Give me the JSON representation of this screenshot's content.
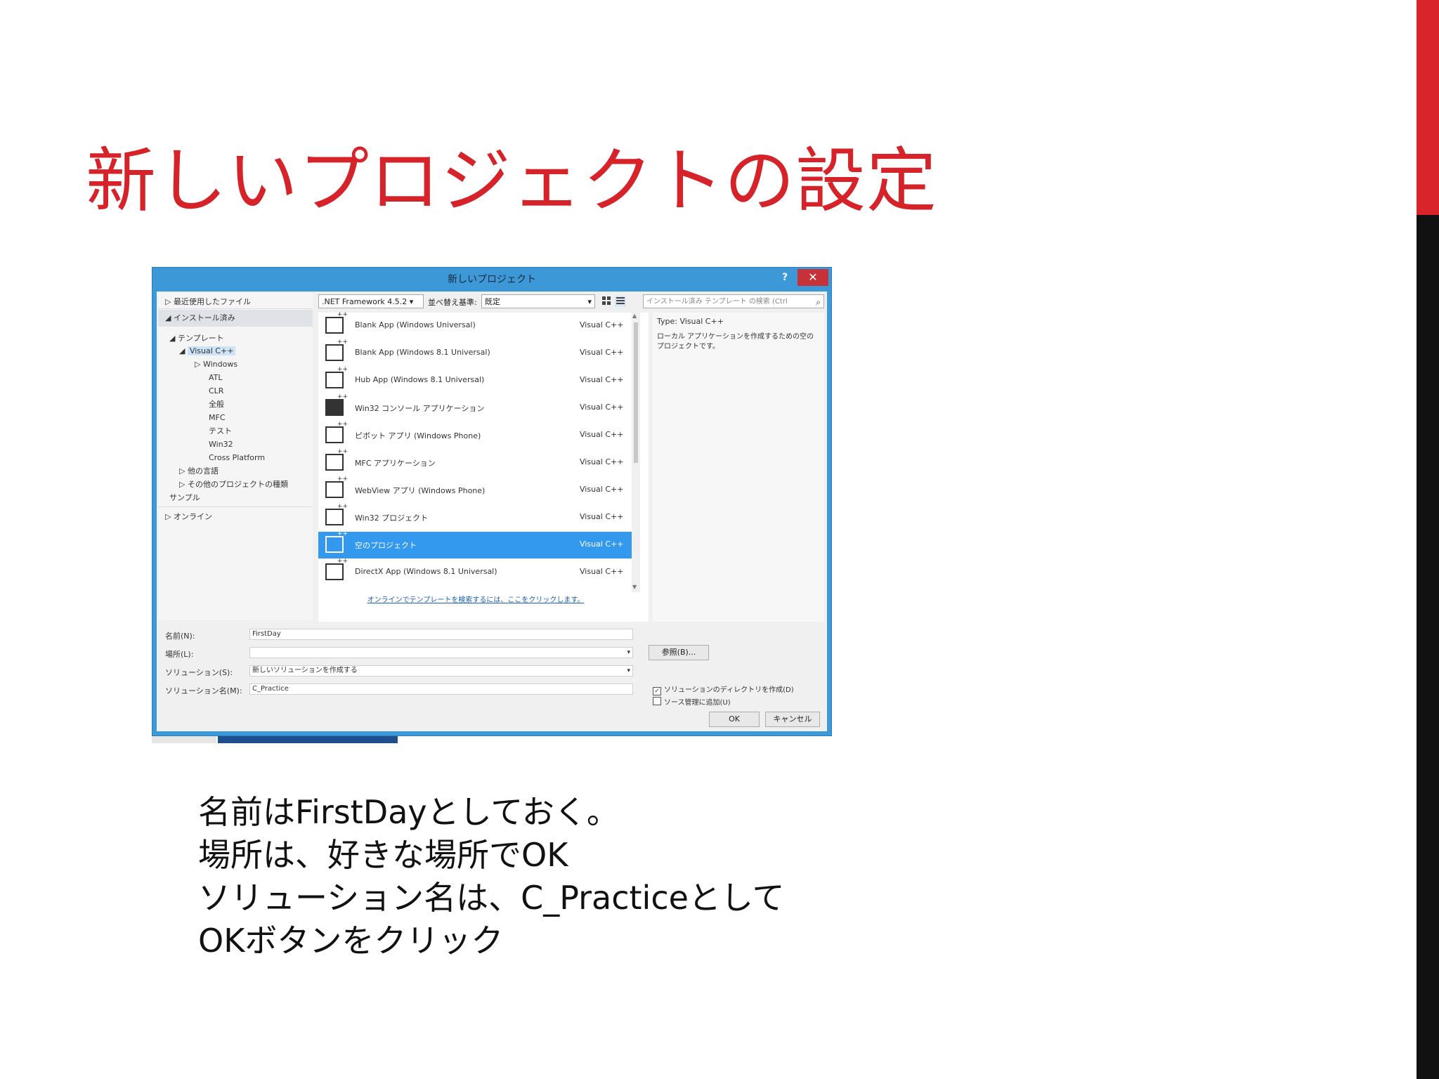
{
  "slide": {
    "title": "新しいプロジェクトの設定",
    "body_lines": [
      "名前はFirstDayとしておく。",
      "場所は、好きな場所でOK",
      "ソリューション名は、C_Practiceとして",
      "OKボタンをクリック"
    ]
  },
  "dialog": {
    "title": "新しいプロジェクト",
    "help_label": "?",
    "close_label": "✕",
    "nav": {
      "recent": "▷ 最近使用したファイル",
      "installed": "◢ インストール済み",
      "templates": "◢ テンプレート",
      "visual_cpp": "Visual C++",
      "windows": "▷ Windows",
      "atl": "ATL",
      "clr": "CLR",
      "general": "全般",
      "mfc": "MFC",
      "test": "テスト",
      "win32": "Win32",
      "cross_platform": "Cross Platform",
      "other_languages": "▷ 他の言語",
      "other_project_types": "▷ その他のプロジェクトの種類",
      "samples": "サンプル",
      "online": "▷ オンライン"
    },
    "toolbar": {
      "framework": ".NET Framework 4.5.2",
      "framework_caret": "▾",
      "sort_label": "並べ替え基準:",
      "sort_value": "既定",
      "sort_caret": "▾",
      "grid_view_icon": "grid-view-icon",
      "list_view_icon": "list-view-icon",
      "search_placeholder": "インストール済み テンプレート の検索 (Ctrl",
      "search_icon": "⌕"
    },
    "templates": [
      {
        "name": "Blank App (Windows Universal)",
        "lang": "Visual C++"
      },
      {
        "name": "Blank App (Windows 8.1 Universal)",
        "lang": "Visual C++"
      },
      {
        "name": "Hub App (Windows 8.1 Universal)",
        "lang": "Visual C++"
      },
      {
        "name": "Win32 コンソール アプリケーション",
        "lang": "Visual C++"
      },
      {
        "name": "ピボット アプリ (Windows Phone)",
        "lang": "Visual C++"
      },
      {
        "name": "MFC アプリケーション",
        "lang": "Visual C++"
      },
      {
        "name": "WebView アプリ (Windows Phone)",
        "lang": "Visual C++"
      },
      {
        "name": "Win32 プロジェクト",
        "lang": "Visual C++"
      },
      {
        "name": "空のプロジェクト",
        "lang": "Visual C++"
      },
      {
        "name": "DirectX App (Windows 8.1 Universal)",
        "lang": "Visual C++"
      }
    ],
    "selected_template_index": 8,
    "online_link": "オンラインでテンプレートを検索するには、ここをクリックします。",
    "details": {
      "type_line": "Type:  Visual C++",
      "description": "ローカル アプリケーションを作成するための空のプロジェクトです。"
    },
    "form": {
      "name_label": "名前(N):",
      "name_value": "FirstDay",
      "location_label": "場所(L):",
      "location_value": "",
      "location_caret": "▾",
      "solution_label": "ソリューション(S):",
      "solution_value": "新しいソリューションを作成する",
      "solution_caret": "▾",
      "solution_name_label": "ソリューション名(M):",
      "solution_name_value": "C_Practice",
      "browse_button": "参照(B)...",
      "create_dir_checkbox": "ソリューションのディレクトリを作成(D)",
      "create_dir_checked": true,
      "source_control_checkbox": "ソース管理に追加(U)",
      "source_control_checked": false,
      "ok_button": "OK",
      "cancel_button": "キャンセル"
    }
  },
  "colors": {
    "title_red": "#d6232a",
    "accent_red": "#d9242b",
    "accent_dark": "#111111",
    "dialog_frame": "#3c98d6",
    "selection_blue": "#3399ee"
  }
}
